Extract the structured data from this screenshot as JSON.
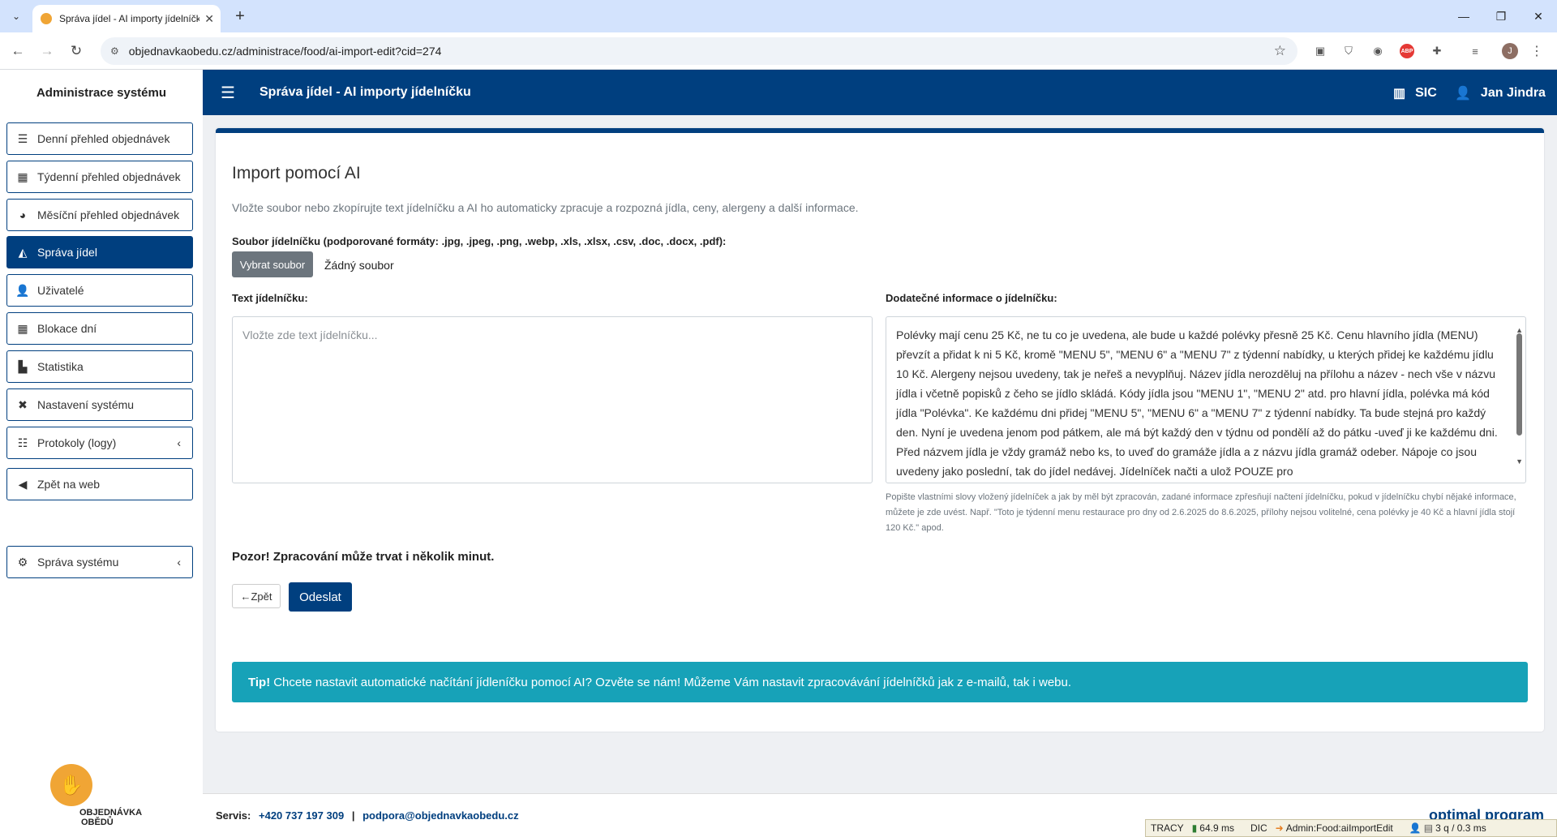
{
  "browser": {
    "tab_title": "Správa jídel - AI importy jídelníčku",
    "url": "objednavkaobedu.cz/administrace/food/ai-import-edit?cid=274",
    "profile_initial": "J",
    "abp_label": "ABP"
  },
  "sidebar": {
    "title": "Administrace systému",
    "items": [
      {
        "label": "Denní přehled objednávek"
      },
      {
        "label": "Týdenní přehled objednávek"
      },
      {
        "label": "Měsíční přehled objednávek"
      },
      {
        "label": "Správa jídel"
      },
      {
        "label": "Uživatelé"
      },
      {
        "label": "Blokace dní"
      },
      {
        "label": "Statistika"
      },
      {
        "label": "Nastavení systému"
      },
      {
        "label": "Protokoly (logy)"
      },
      {
        "label": "Zpět na web"
      },
      {
        "label": "Správa systému"
      }
    ],
    "logo_line1": "OBJEDNÁVKA",
    "logo_line2": "OBĚDŮ"
  },
  "header": {
    "title": "Správa jídel - AI importy jídelníčku",
    "org": "SIC",
    "user": "Jan Jindra"
  },
  "main": {
    "heading": "Import pomocí AI",
    "description": "Vložte soubor nebo zkopírujte text jídelníčku a AI ho automaticky zpracuje a rozpozná jídla, ceny, alergeny a další informace.",
    "file_label": "Soubor jídelníčku (podporované formáty: .jpg, .jpeg, .png, .webp, .xls, .xlsx, .csv, .doc, .docx, .pdf):",
    "file_button": "Vybrat soubor",
    "file_none": "Žádný soubor",
    "text_label": "Text jídelníčku:",
    "text_placeholder": "Vložte zde text jídelníčku...",
    "extra_label": "Dodatečné informace o jídelníčku:",
    "extra_value": "Polévky mají cenu 25 Kč, ne tu co je uvedena, ale bude u každé polévky přesně 25 Kč. Cenu hlavního jídla (MENU) převzít a přidat k ni 5 Kč, kromě \"MENU 5\", \"MENU 6\" a \"MENU 7\" z týdenní nabídky, u kterých přidej ke každému jídlu 10 Kč. Alergeny nejsou uvedeny, tak je neřeš a nevyplňuj. Název jídla nerozděluj na přílohu a název - nech vše v názvu jídla i včetně popisků z čeho se jídlo skládá. Kódy jídla jsou \"MENU 1\", \"MENU 2\" atd. pro hlavní jídla, polévka má kód jídla \"Polévka\". Ke každému dni přidej \"MENU 5\", \"MENU 6\" a \"MENU 7\" z týdenní nabídky. Ta bude stejná pro každý den. Nyní je uvedena jenom pod pátkem, ale má být každý den v týdnu od pondělí až do pátku -uveď ji ke každému dni. Před názvem jídla je vždy gramáž nebo ks, to uveď do gramáže jídla a z názvu jídla gramáž odeber. Nápoje co jsou uvedeny jako poslední, tak do jídel nedávej. Jídelníček načti a ulož POUZE pro",
    "hint": "Popište vlastními slovy vložený jídelníček a jak by měl být zpracován, zadané informace zpřesňují načtení jídelníčku, pokud v jídelníčku chybí nějaké informace, můžete je zde uvést. Např. \"Toto je týdenní menu restaurace pro dny od 2.6.2025 do 8.6.2025, přílohy nejsou volitelné, cena polévky je 40 Kč a hlavní jídla stojí 120 Kč.\" apod.",
    "warning": "Pozor! Zpracování může trvat i několik minut.",
    "back_label": "Zpět",
    "submit_label": "Odeslat",
    "tip_bold": "Tip!",
    "tip_text": "Chcete nastavit automatické načítání jídleníčku pomocí AI? Ozvěte se nám! Můžeme Vám nastavit zpracovávání jídelníčků jak z e-mailů, tak i webu."
  },
  "footer": {
    "service_label": "Servis:",
    "phone": "+420 737 197 309",
    "separator": "|",
    "email": "podpora@objednavkaobedu.cz",
    "brand": "optimal program"
  },
  "tracy": {
    "label": "TRACY",
    "time": "64.9 ms",
    "di": "DIC",
    "route": "Admin:Food:aiImportEdit",
    "queries": "3 q / 0.3 ms"
  }
}
